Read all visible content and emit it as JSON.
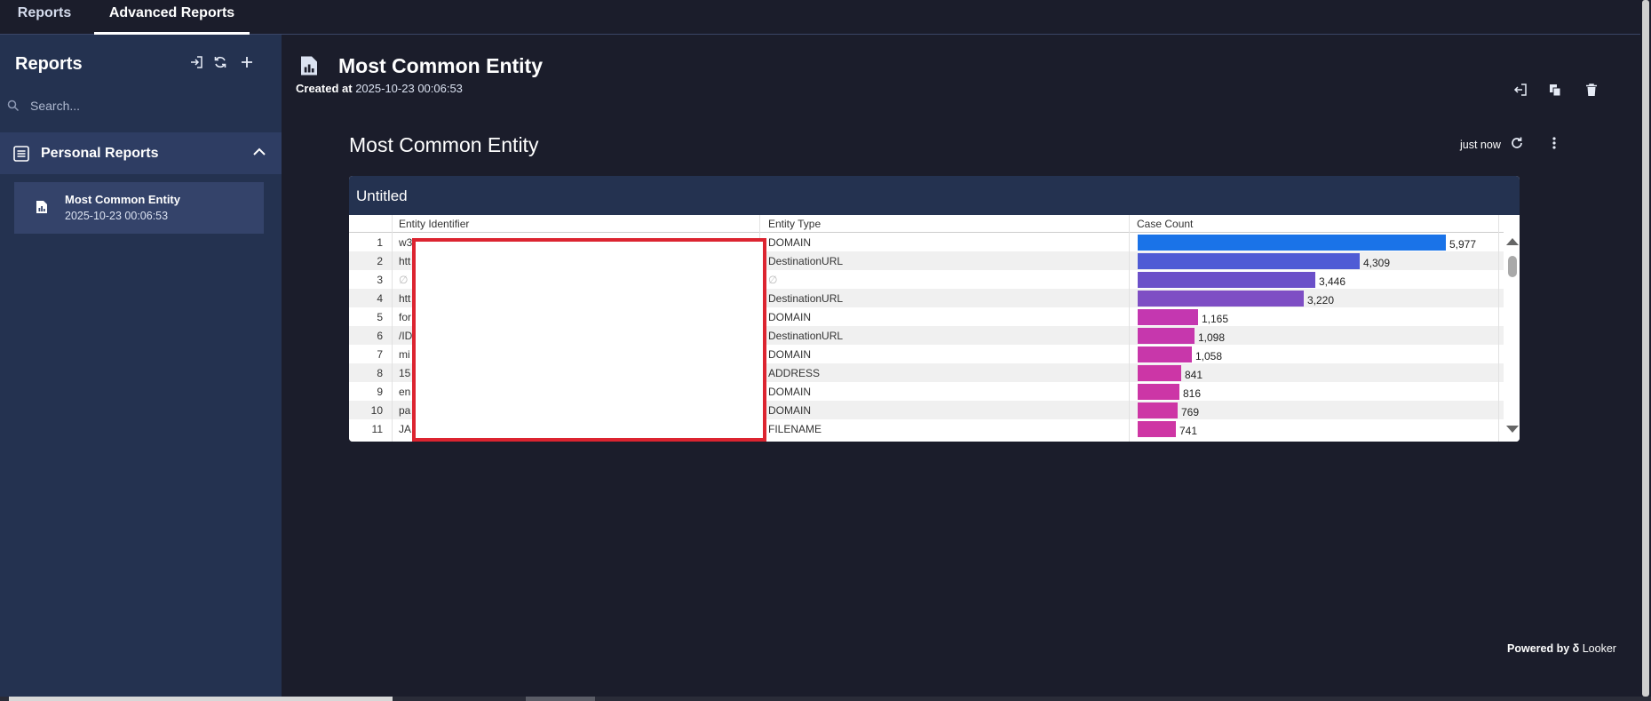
{
  "top_tabs": [
    {
      "label": "Reports"
    },
    {
      "label": "Advanced Reports"
    }
  ],
  "sidebar": {
    "title": "Reports",
    "search_placeholder": "Search...",
    "section_label": "Personal Reports",
    "items": [
      {
        "name": "Most Common Entity",
        "date": "2025-10-23 00:06:53"
      }
    ]
  },
  "header": {
    "title": "Most Common Entity",
    "created_label": "Created at",
    "created_value": "2025-10-23 00:06:53"
  },
  "dashboard": {
    "title": "Most Common Entity",
    "updated": "just now",
    "tile_title": "Untitled"
  },
  "table": {
    "columns": [
      "Entity Identifier",
      "Entity Type",
      "Case Count"
    ],
    "rows": [
      {
        "n": "1",
        "eid": "w3",
        "type": "DOMAIN",
        "count": 5977,
        "count_label": "5,977",
        "color": "#1a73e8"
      },
      {
        "n": "2",
        "eid": "htt",
        "type": "DestinationURL",
        "count": 4309,
        "count_label": "4,309",
        "color": "#4f5bd5"
      },
      {
        "n": "3",
        "eid": "∅",
        "type": "∅",
        "count": 3446,
        "count_label": "3,446",
        "color": "#6b50c9"
      },
      {
        "n": "4",
        "eid": "htt",
        "type": "DestinationURL",
        "count": 3220,
        "count_label": "3,220",
        "color": "#7e4ec4"
      },
      {
        "n": "5",
        "eid": "for",
        "type": "DOMAIN",
        "count": 1165,
        "count_label": "1,165",
        "color": "#c437b0"
      },
      {
        "n": "6",
        "eid": "/ID",
        "type": "DestinationURL",
        "count": 1098,
        "count_label": "1,098",
        "color": "#c637ad"
      },
      {
        "n": "7",
        "eid": "mi",
        "type": "DOMAIN",
        "count": 1058,
        "count_label": "1,058",
        "color": "#c837aa"
      },
      {
        "n": "8",
        "eid": "15",
        "type": "ADDRESS",
        "count": 841,
        "count_label": "841",
        "color": "#cc36a6"
      },
      {
        "n": "9",
        "eid": "en",
        "type": "DOMAIN",
        "count": 816,
        "count_label": "816",
        "color": "#cc36a6"
      },
      {
        "n": "10",
        "eid": "pa",
        "type": "DOMAIN",
        "count": 769,
        "count_label": "769",
        "color": "#cd36a5"
      },
      {
        "n": "11",
        "eid": "JA",
        "type": "FILENAME",
        "count": 741,
        "count_label": "741",
        "color": "#ce36a4"
      }
    ],
    "max_count": 5977
  },
  "footer": {
    "powered_by": "Powered by",
    "brand": "Looker"
  }
}
